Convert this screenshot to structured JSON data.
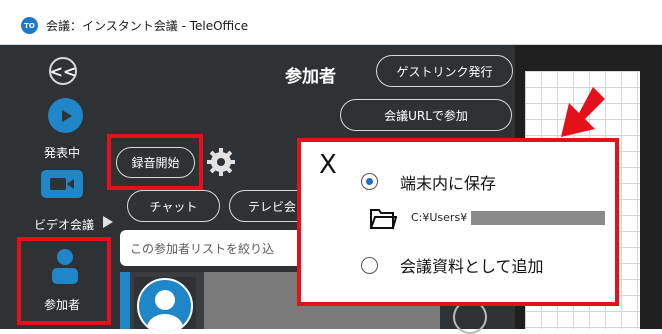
{
  "window": {
    "app_icon_text": "TO",
    "title": "会議：インスタント会議 - TeleOffice"
  },
  "sidebar": {
    "back_symbol": "<<",
    "items": [
      {
        "label": "発表中",
        "icon": "play-icon"
      },
      {
        "label": "ビデオ会議",
        "icon": "video-camera-icon"
      },
      {
        "label": "参加者",
        "icon": "person-icon"
      }
    ]
  },
  "panel": {
    "title": "参加者",
    "guest_link_button": "ゲストリンク発行",
    "join_url_button": "会議URLで参加",
    "record_button": "録音開始",
    "chat_tab": "チャット",
    "tv_tab": "テレビ会",
    "filter_placeholder": "この参加者リストを絞り込"
  },
  "popup": {
    "close_symbol": "X",
    "options": [
      {
        "label": "端末内に保存",
        "selected": true
      },
      {
        "label": "会議資料として追加",
        "selected": false
      }
    ],
    "path_text": "C:¥Users¥"
  },
  "colors": {
    "highlight": "#e4101a",
    "accent": "#1f86c8",
    "panel_bg": "#2f3234"
  }
}
